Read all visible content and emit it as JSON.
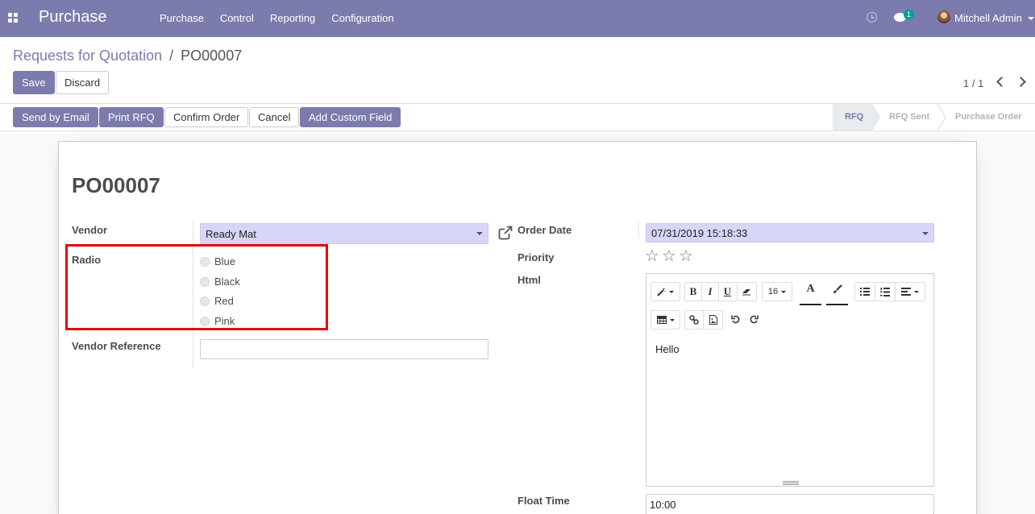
{
  "navbar": {
    "app_name": "Purchase",
    "menu": [
      "Purchase",
      "Control",
      "Reporting",
      "Configuration"
    ],
    "chat_badge": "1",
    "user_name": "Mitchell Admin",
    "color": "#7c7bad"
  },
  "breadcrumb": {
    "parent": "Requests for Quotation",
    "separator": "/",
    "current": "PO00007"
  },
  "buttons": {
    "save": "Save",
    "discard": "Discard",
    "send_by_email": "Send by Email",
    "print_rfq": "Print RFQ",
    "confirm_order": "Confirm Order",
    "cancel": "Cancel",
    "add_custom_field": "Add Custom Field"
  },
  "pager": {
    "value": "1 / 1"
  },
  "status_stages": [
    "RFQ",
    "RFQ Sent",
    "Purchase Order"
  ],
  "status_active": "RFQ",
  "form": {
    "title": "PO00007",
    "vendor_label": "Vendor",
    "vendor_value": "Ready Mat",
    "radio_label": "Radio",
    "radio_options": [
      "Blue",
      "Black",
      "Red",
      "Pink"
    ],
    "vendor_reference_label": "Vendor Reference",
    "vendor_reference_value": "",
    "order_date_label": "Order Date",
    "order_date_value": "07/31/2019 15:18:33",
    "priority_label": "Priority",
    "priority_stars": 0,
    "priority_max": 3,
    "html_label": "Html",
    "html_content": "Hello",
    "font_size": "16",
    "float_time_label": "Float Time",
    "float_time_value": "10:00"
  },
  "icons": {
    "apps": "apps-grid-icon",
    "activity": "clock-icon",
    "messaging": "chat-icon",
    "external_link": "external-link-icon",
    "star": "star-outline-icon"
  }
}
